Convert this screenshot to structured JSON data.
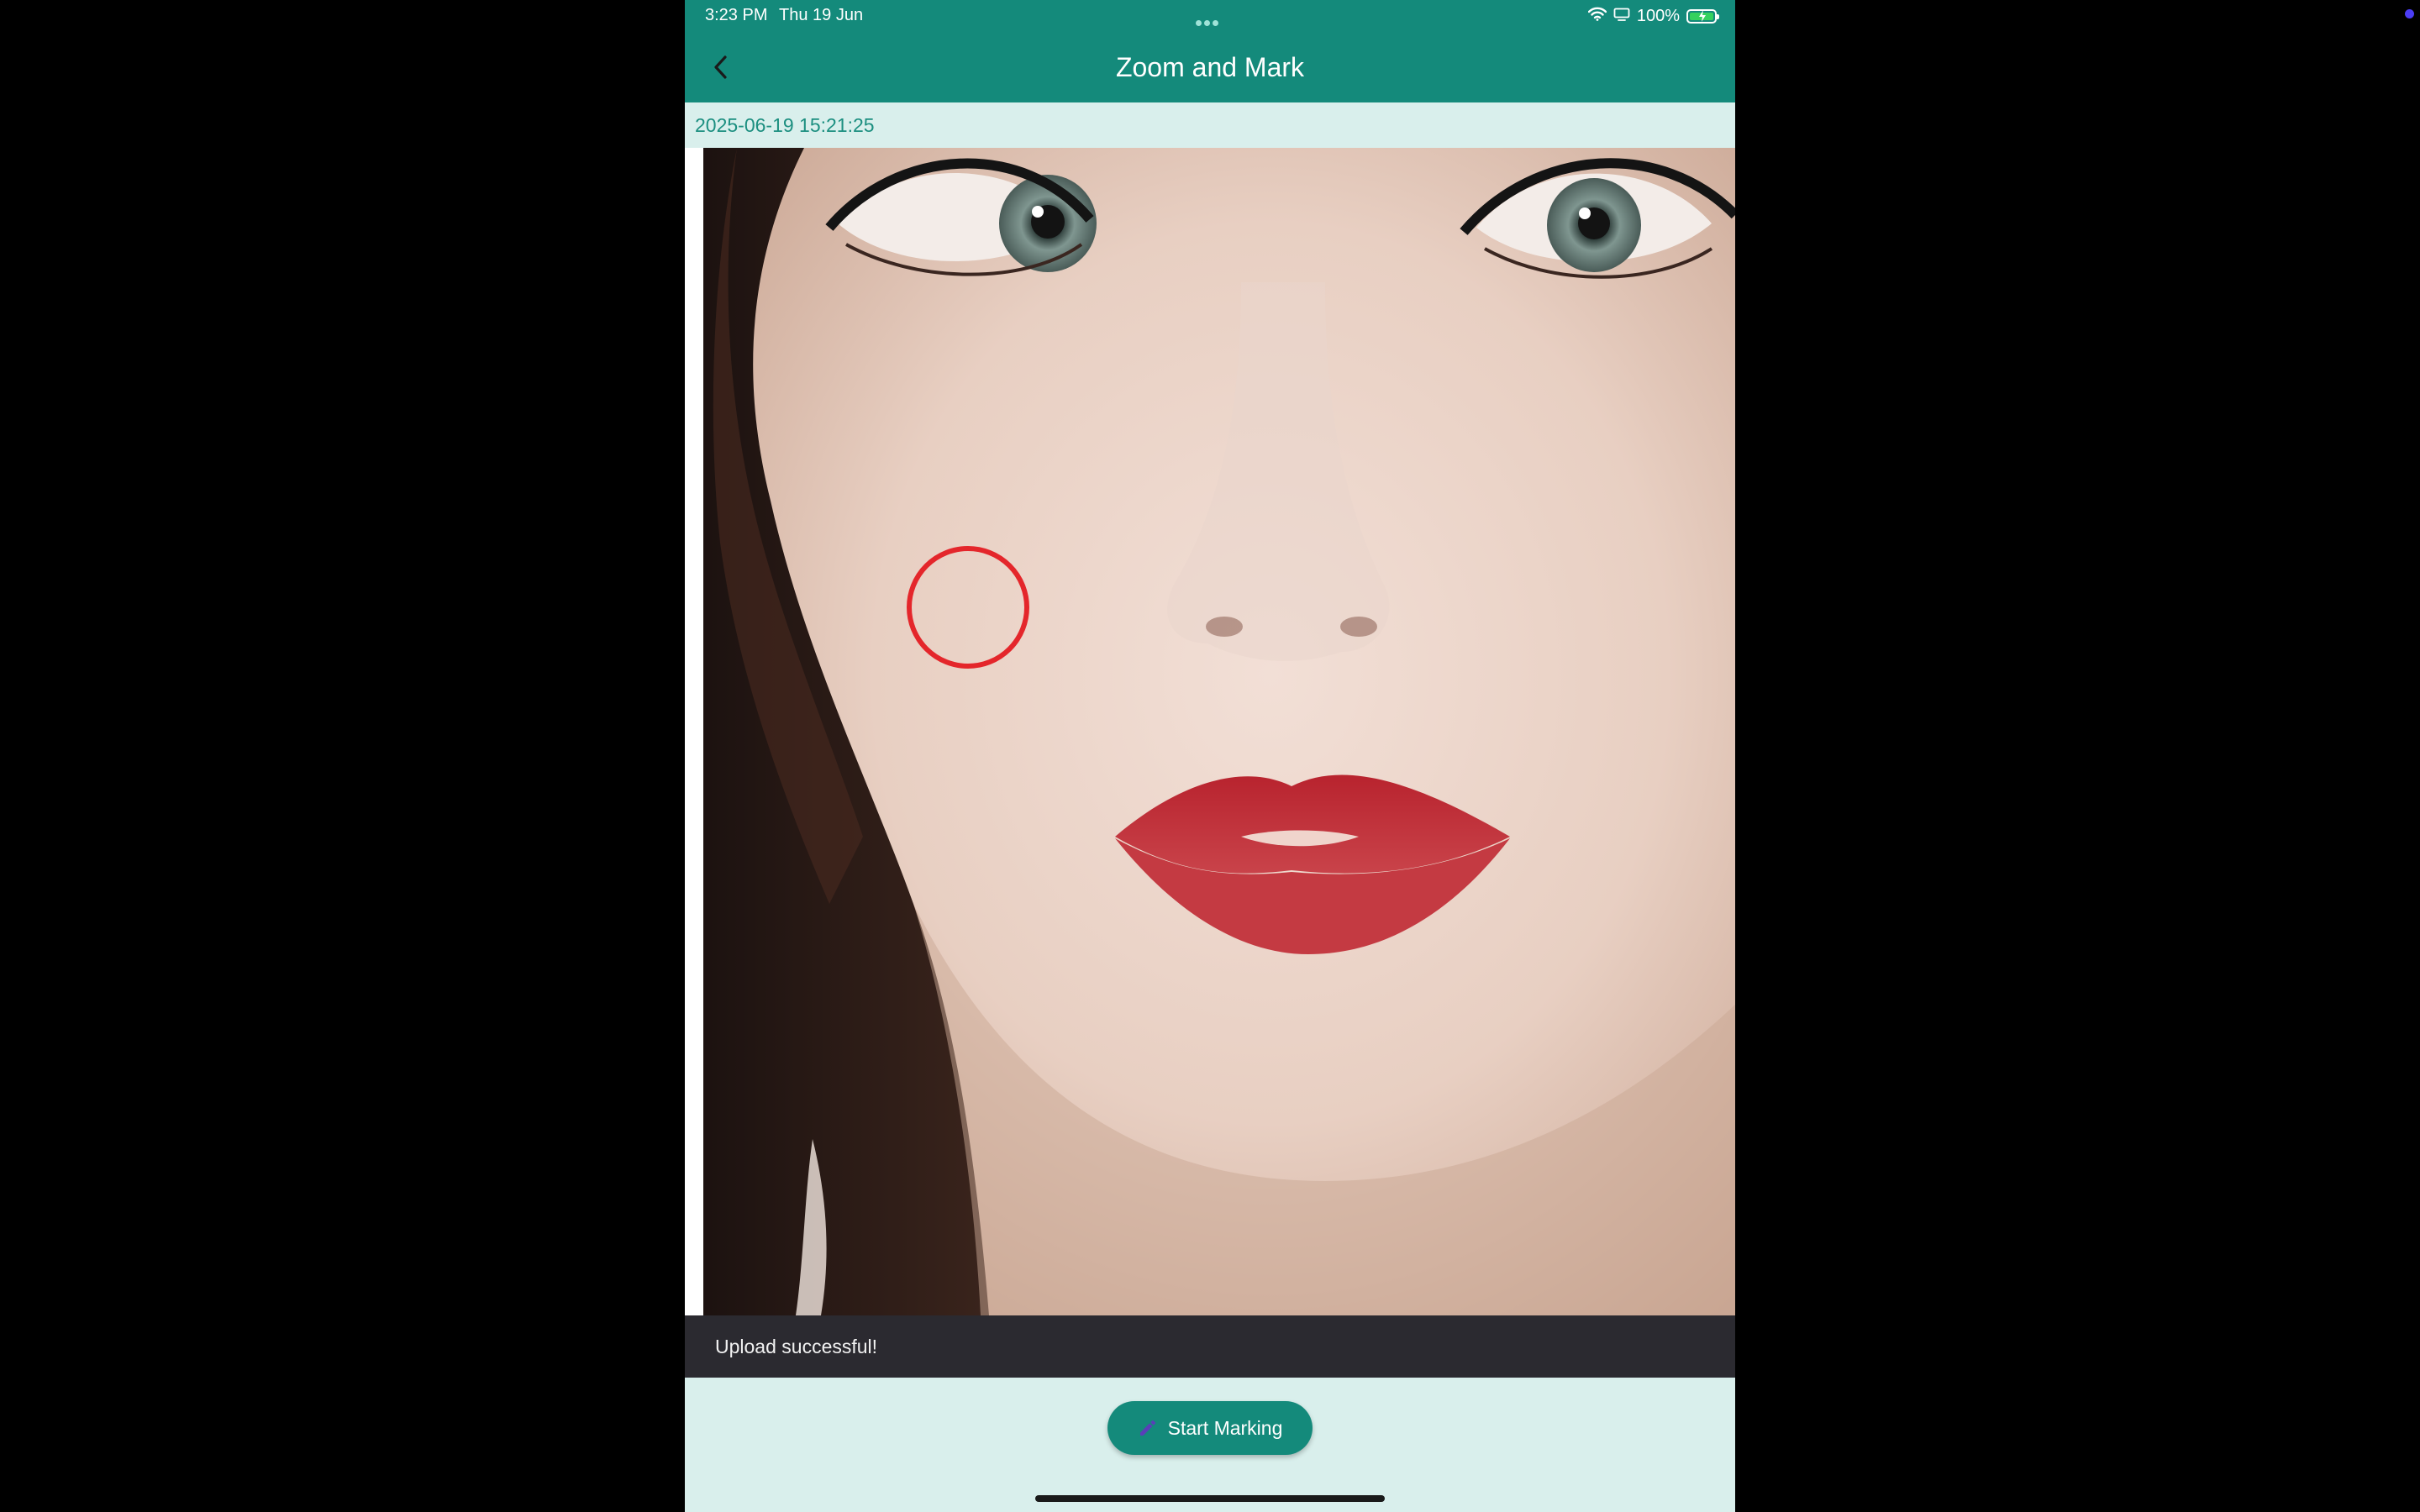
{
  "status_bar": {
    "time": "3:23 PM",
    "date": "Thu 19 Jun",
    "battery": "100%"
  },
  "nav": {
    "title": "Zoom and Mark"
  },
  "photo": {
    "timestamp": "2025-06-19 15:21:25",
    "mark_color": "#e4262b"
  },
  "toast": {
    "message": "Upload successful!"
  },
  "actions": {
    "start_marking_label": "Start Marking"
  },
  "colors": {
    "header": "#148a7b",
    "background": "#d9efec",
    "timestamp_text": "#1c8f80",
    "toast_bg": "#2b2a30"
  },
  "icons": {
    "back": "chevron-left-icon",
    "pencil": "pencil-icon",
    "wifi": "wifi-icon",
    "airplay": "screen-mirroring-icon",
    "battery": "battery-charging-icon"
  }
}
